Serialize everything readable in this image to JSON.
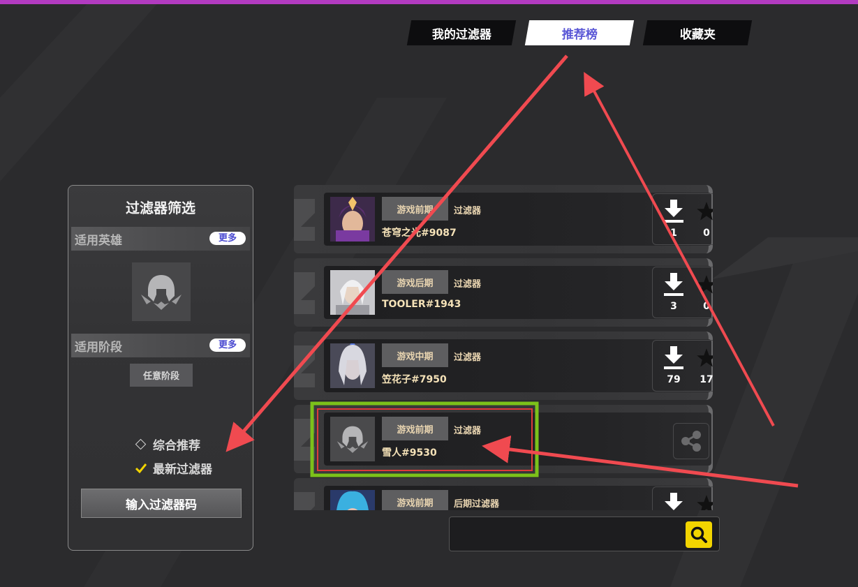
{
  "tabs": [
    {
      "label": "我的过滤器",
      "active": false
    },
    {
      "label": "推荐榜",
      "active": true
    },
    {
      "label": "收藏夹",
      "active": false
    }
  ],
  "panel": {
    "title": "过滤器筛选",
    "hero_section": {
      "label": "适用英雄",
      "more": "更多"
    },
    "stage_section": {
      "label": "适用阶段",
      "more": "更多",
      "selected_stage": "任意阶段"
    },
    "sort_options": [
      {
        "label": "综合推荐",
        "selected": false
      },
      {
        "label": "最新过滤器",
        "selected": true
      }
    ],
    "input_code_button": "输入过滤器码"
  },
  "filters": [
    {
      "phase": "游戏前期",
      "type": "过滤器",
      "author": "苍穹之光#9087",
      "downloads": "1",
      "stars": "0",
      "avatar": "hero-portrait-purple"
    },
    {
      "phase": "游戏后期",
      "type": "过滤器",
      "author": "TOOLER#1943",
      "downloads": "3",
      "stars": "0",
      "avatar": "hero-portrait-white"
    },
    {
      "phase": "游戏中期",
      "type": "过滤器",
      "author": "笠花子#7950",
      "downloads": "79",
      "stars": "17",
      "avatar": "hero-portrait-silver"
    },
    {
      "phase": "游戏前期",
      "type": "过滤器",
      "author": "雪人#9530",
      "avatar": "default-helmet-icon",
      "highlighted": true
    },
    {
      "phase": "游戏前期",
      "type": "后期过滤器",
      "author": "",
      "downloads": "",
      "stars": "",
      "avatar": "hero-portrait-blue"
    }
  ],
  "search": {
    "placeholder": "",
    "value": ""
  },
  "colors": {
    "accent_bar": "#b23bc0",
    "active_tab_text": "#5a57d6",
    "highlight_outer": "#7cc11a",
    "highlight_inner": "#e03a3a",
    "annotation_arrow": "#f04a50",
    "search_button": "#f2d400"
  }
}
